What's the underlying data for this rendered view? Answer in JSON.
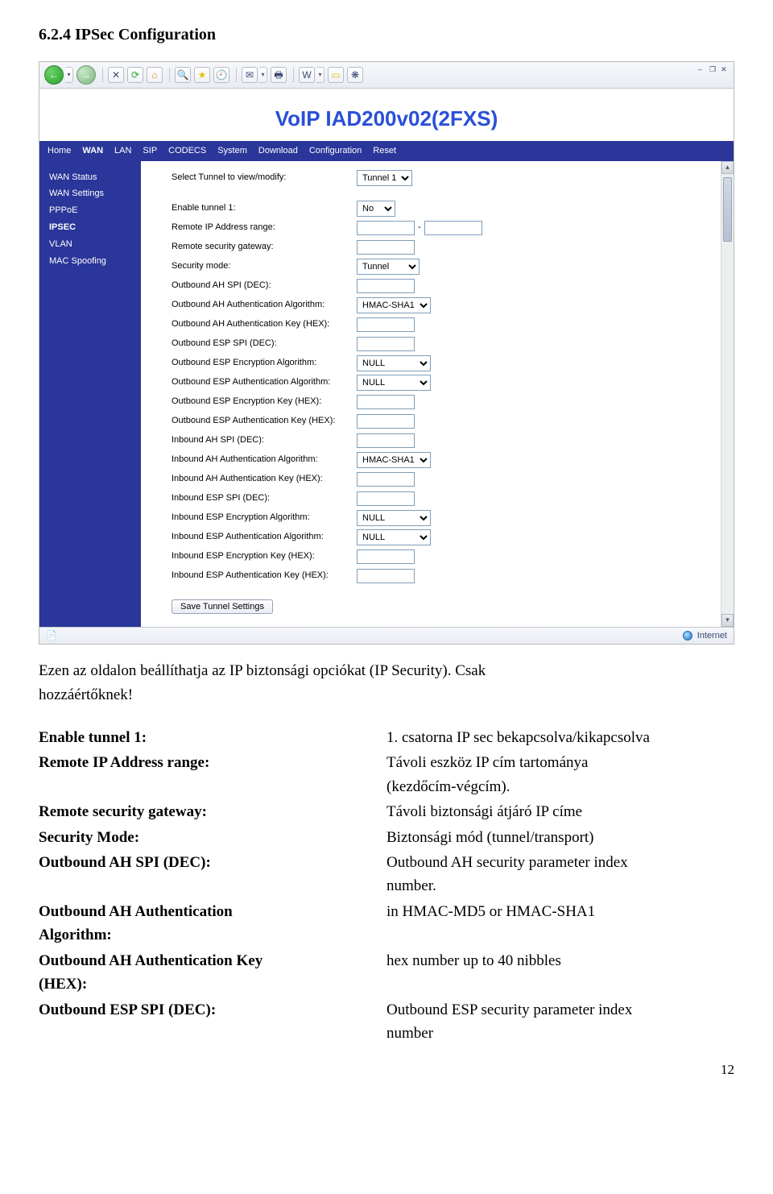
{
  "header": {
    "section_title": "6.2.4 IPSec Configuration"
  },
  "toolbar": {
    "back": "←",
    "fwd": "→",
    "stop": "✕",
    "refresh": "⟳",
    "home": "⌂",
    "search": "🔍",
    "fav": "★",
    "history": "🕘",
    "mail": "✉",
    "print": "🖶",
    "word": "W",
    "notes": "▭",
    "msn": "❋"
  },
  "banner": {
    "brand": "VoIP IAD200v02(2FXS)"
  },
  "menu": {
    "items": [
      "Home",
      "WAN",
      "LAN",
      "SIP",
      "CODECS",
      "System",
      "Download",
      "Configuration",
      "Reset"
    ],
    "active": "WAN"
  },
  "sidebar": {
    "items": [
      "WAN Status",
      "WAN Settings",
      "PPPoE",
      "IPSEC",
      "VLAN",
      "MAC Spoofing"
    ],
    "active": "IPSEC"
  },
  "form": {
    "select_tunnel_label": "Select Tunnel to view/modify:",
    "select_tunnel_value": "Tunnel 1",
    "enable_tunnel_label": "Enable tunnel 1:",
    "enable_tunnel_value": "No",
    "remote_ip_label": "Remote IP Address range:",
    "remote_ip_sep": "-",
    "remote_gw_label": "Remote security gateway:",
    "security_mode_label": "Security mode:",
    "security_mode_value": "Tunnel",
    "out_ah_spi_label": "Outbound AH SPI (DEC):",
    "out_ah_auth_algo_label": "Outbound AH Authentication Algorithm:",
    "out_ah_auth_algo_value": "HMAC-SHA1",
    "out_ah_auth_key_label": "Outbound AH Authentication Key (HEX):",
    "out_esp_spi_label": "Outbound ESP SPI (DEC):",
    "out_esp_enc_algo_label": "Outbound ESP Encryption Algorithm:",
    "out_esp_enc_algo_value": "NULL",
    "out_esp_auth_algo_label": "Outbound ESP Authentication Algorithm:",
    "out_esp_auth_algo_value": "NULL",
    "out_esp_enc_key_label": "Outbound ESP Encryption Key (HEX):",
    "out_esp_auth_key_label": "Outbound ESP Authentication Key (HEX):",
    "in_ah_spi_label": "Inbound AH SPI (DEC):",
    "in_ah_auth_algo_label": "Inbound AH Authentication Algorithm:",
    "in_ah_auth_algo_value": "HMAC-SHA1",
    "in_ah_auth_key_label": "Inbound AH Authentication Key (HEX):",
    "in_esp_spi_label": "Inbound ESP SPI (DEC):",
    "in_esp_enc_algo_label": "Inbound ESP Encryption Algorithm:",
    "in_esp_enc_algo_value": "NULL",
    "in_esp_auth_algo_label": "Inbound ESP Authentication Algorithm:",
    "in_esp_auth_algo_value": "NULL",
    "in_esp_enc_key_label": "Inbound ESP Encryption Key (HEX):",
    "in_esp_auth_key_label": "Inbound ESP Authentication Key (HEX):",
    "save_label": "Save Tunnel Settings"
  },
  "statusbar": {
    "zone": "Internet"
  },
  "caption": {
    "line1": "Ezen az oldalon beállíthatja az IP biztonsági opciókat (IP Security). Csak",
    "line2": "hozzáértőknek!"
  },
  "defs": {
    "r1t": "Enable tunnel 1:",
    "r1d": "1. csatorna IP sec bekapcsolva/kikapcsolva",
    "r2t": "Remote IP Address range:",
    "r2d1": "Távoli eszköz IP cím tartománya",
    "r2d2": "(kezdőcím-végcím).",
    "r3t": "Remote security gateway:",
    "r3d": "Távoli biztonsági átjáró IP címe",
    "r4t": "Security Mode:",
    "r4d": "Biztonsági mód (tunnel/transport)",
    "r5t": "Outbound AH SPI (DEC):",
    "r5d1": "Outbound AH security parameter index",
    "r5d2": "number.",
    "r6t1": "Outbound AH Authentication",
    "r6t2": "Algorithm:",
    "r6d": "in HMAC-MD5 or HMAC-SHA1",
    "r7t1": "Outbound AH Authentication Key",
    "r7t2": "(HEX):",
    "r7d": "hex number up to 40 nibbles",
    "r8t": "Outbound ESP SPI (DEC):",
    "r8d1": "Outbound ESP security parameter index",
    "r8d2": "number"
  },
  "page_number": "12"
}
